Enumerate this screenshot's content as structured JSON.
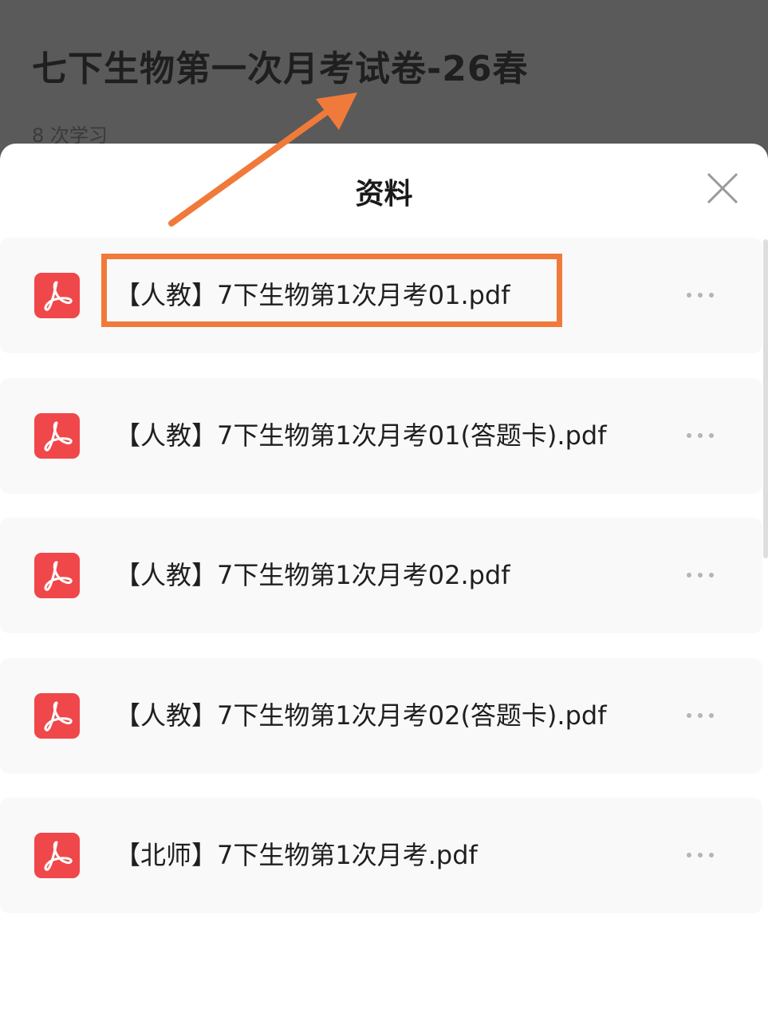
{
  "background_page": {
    "title": "七下生物第一次月考试卷-26春",
    "meta": "8 次学习"
  },
  "sheet": {
    "title": "资料",
    "close_icon": "close-icon"
  },
  "files": [
    {
      "name": "【人教】7下生物第1次月考01.pdf",
      "icon": "pdf-icon",
      "more_icon": "more-icon"
    },
    {
      "name": "【人教】7下生物第1次月考01(答题卡).pdf",
      "icon": "pdf-icon",
      "more_icon": "more-icon"
    },
    {
      "name": "【人教】7下生物第1次月考02.pdf",
      "icon": "pdf-icon",
      "more_icon": "more-icon"
    },
    {
      "name": "【人教】7下生物第1次月考02(答题卡).pdf",
      "icon": "pdf-icon",
      "more_icon": "more-icon"
    },
    {
      "name": "【北师】7下生物第1次月考.pdf",
      "icon": "pdf-icon",
      "more_icon": "more-icon"
    }
  ],
  "colors": {
    "pdf_red": "#f0474a",
    "highlight_orange": "#f07a3a",
    "overlay": "#5a5a5a",
    "row_bg": "#f9f9f9"
  }
}
